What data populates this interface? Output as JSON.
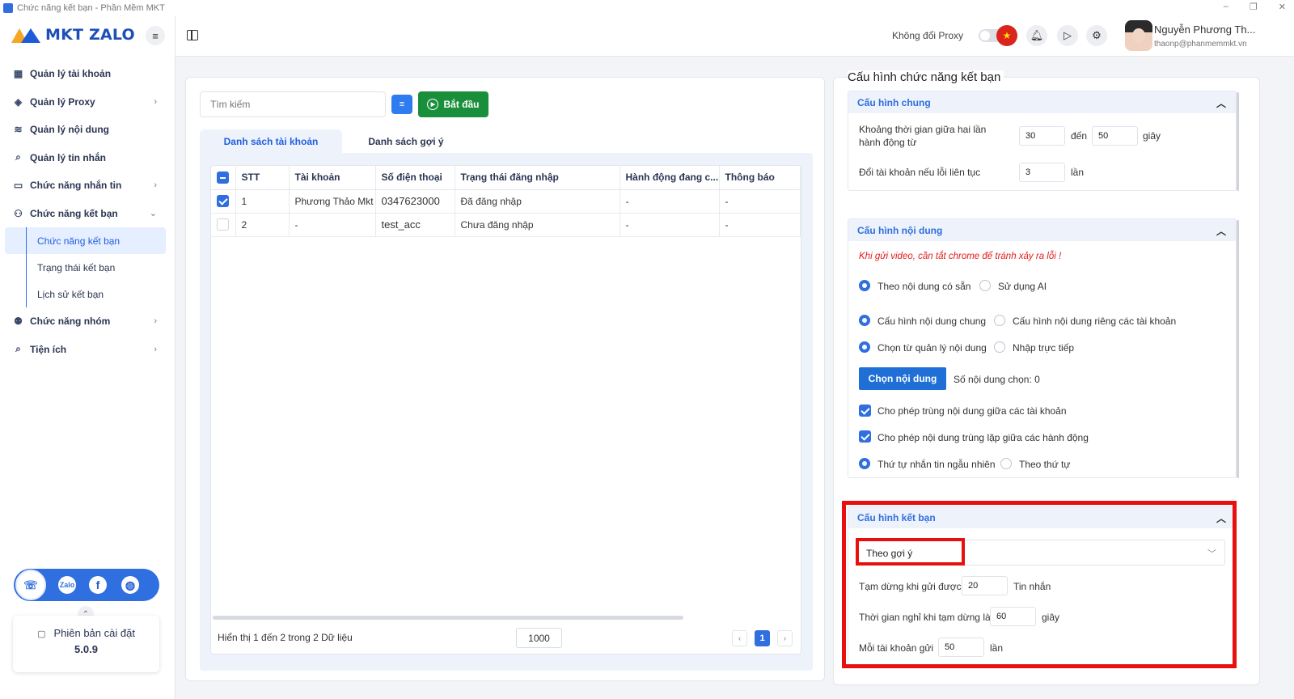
{
  "window": {
    "title": "Chức năng kết bạn - Phần Mềm MKT",
    "controls": [
      "–",
      "❐",
      "✕"
    ]
  },
  "brand": {
    "logo_text": "MKT ZALO"
  },
  "sidebar": {
    "items": [
      {
        "label": "Quản lý tài khoản",
        "icon": "grid-icon"
      },
      {
        "label": "Quản lý Proxy",
        "icon": "layers-icon",
        "chevron": "›"
      },
      {
        "label": "Quản lý nội dung",
        "icon": "lines-icon"
      },
      {
        "label": "Quản lý tin nhắn",
        "icon": "search-icon"
      },
      {
        "label": "Chức năng nhắn tin",
        "icon": "chat-icon",
        "chevron": "›"
      },
      {
        "label": "Chức năng kết bạn",
        "icon": "add-user-icon",
        "chevron": "⌄"
      }
    ],
    "sub_items": [
      "Chức năng kết bạn",
      "Trạng thái kết bạn",
      "Lịch sử kết bạn"
    ],
    "items_after": [
      {
        "label": "Chức năng nhóm",
        "icon": "group-icon",
        "chevron": "›"
      },
      {
        "label": "Tiện ích",
        "icon": "search-icon",
        "chevron": "›"
      }
    ],
    "social": {
      "zalo": "Zalo",
      "facebook": "f"
    },
    "version_label": "Phiên bản cài đặt",
    "version": "5.0.9"
  },
  "header": {
    "proxy_label": "Không đổi Proxy",
    "user_name": "Nguyễn Phương Th...",
    "user_email": "thaonp@phanmemmkt.vn"
  },
  "left": {
    "search_placeholder": "Tìm kiếm",
    "start_label": "Bắt đầu",
    "tabs": [
      "Danh sách tài khoản",
      "Danh sách gợi ý"
    ],
    "columns": [
      "STT",
      "Tài khoản",
      "Số điện thoại",
      "Trạng thái đăng nhập",
      "Hành động đang c...",
      "Thông báo"
    ],
    "rows": [
      {
        "checked": true,
        "stt": "1",
        "account": "Phương Thảo Mkt",
        "phone": "0347623000",
        "status": "Đã đăng nhập",
        "action": "-",
        "notice": "-"
      },
      {
        "checked": false,
        "stt": "2",
        "account": "-",
        "phone": "test_acc",
        "status": "Chưa đăng nhập",
        "action": "-",
        "notice": "-"
      }
    ],
    "footer_text": "Hiển thị 1 đến 2 trong 2 Dữ liệu",
    "page_size": "1000",
    "pagination": {
      "prev": "‹",
      "current": "1",
      "next": "›"
    }
  },
  "right": {
    "title": "Cấu hình chức năng kết bạn",
    "general": {
      "heading": "Cấu hình chung",
      "interval_label": "Khoảng thời gian giữa hai lần hành động từ",
      "interval_from": "30",
      "to_label": "đến",
      "interval_to": "50",
      "seconds_unit": "giây",
      "switch_label": "Đổi tài khoản nếu lỗi liên tục",
      "switch_value": "3",
      "times_unit": "lần"
    },
    "content": {
      "heading": "Cấu hình nội dung",
      "note": "Khi gửi video, cần tắt chrome để tránh xảy ra lỗi !",
      "radio_groups": [
        {
          "options": [
            "Theo nội dung có sẵn",
            "Sử dụng AI"
          ],
          "selected": 0
        },
        {
          "options": [
            "Cấu hình nội dung chung",
            "Cấu hình nội dung riêng các tài khoản"
          ],
          "selected": 0
        },
        {
          "options": [
            "Chọn từ quản lý nội dung",
            "Nhập trực tiếp"
          ],
          "selected": 0
        }
      ],
      "choose_button": "Chọn nội dung",
      "chosen_count": "Số nội dung chọn: 0",
      "checkboxes": [
        {
          "label": "Cho phép trùng nội dung giữa các tài khoản",
          "checked": true
        },
        {
          "label": "Cho phép nội dung trùng lặp giữa các hành động",
          "checked": true
        }
      ],
      "order_group": {
        "options": [
          "Thứ tự nhắn tin ngẫu nhiên",
          "Theo thứ tự"
        ],
        "selected": 0
      }
    },
    "friend": {
      "heading": "Cấu hình kết bạn",
      "mode_selected": "Theo gợi ý",
      "pause_label": "Tạm dừng khi gửi được",
      "pause_value": "20",
      "pause_unit": "Tin nhắn",
      "rest_label": "Thời gian nghỉ khi tạm dừng là",
      "rest_value": "60",
      "rest_unit": "giây",
      "per_account_label": "Mỗi tài khoản gửi",
      "per_account_value": "50",
      "per_account_unit": "lần"
    }
  },
  "colors": {
    "primary": "#2f6fdf",
    "start_green": "#1a8f3b",
    "highlight_red": "#e80f0f",
    "note_red": "#e11b1b"
  }
}
